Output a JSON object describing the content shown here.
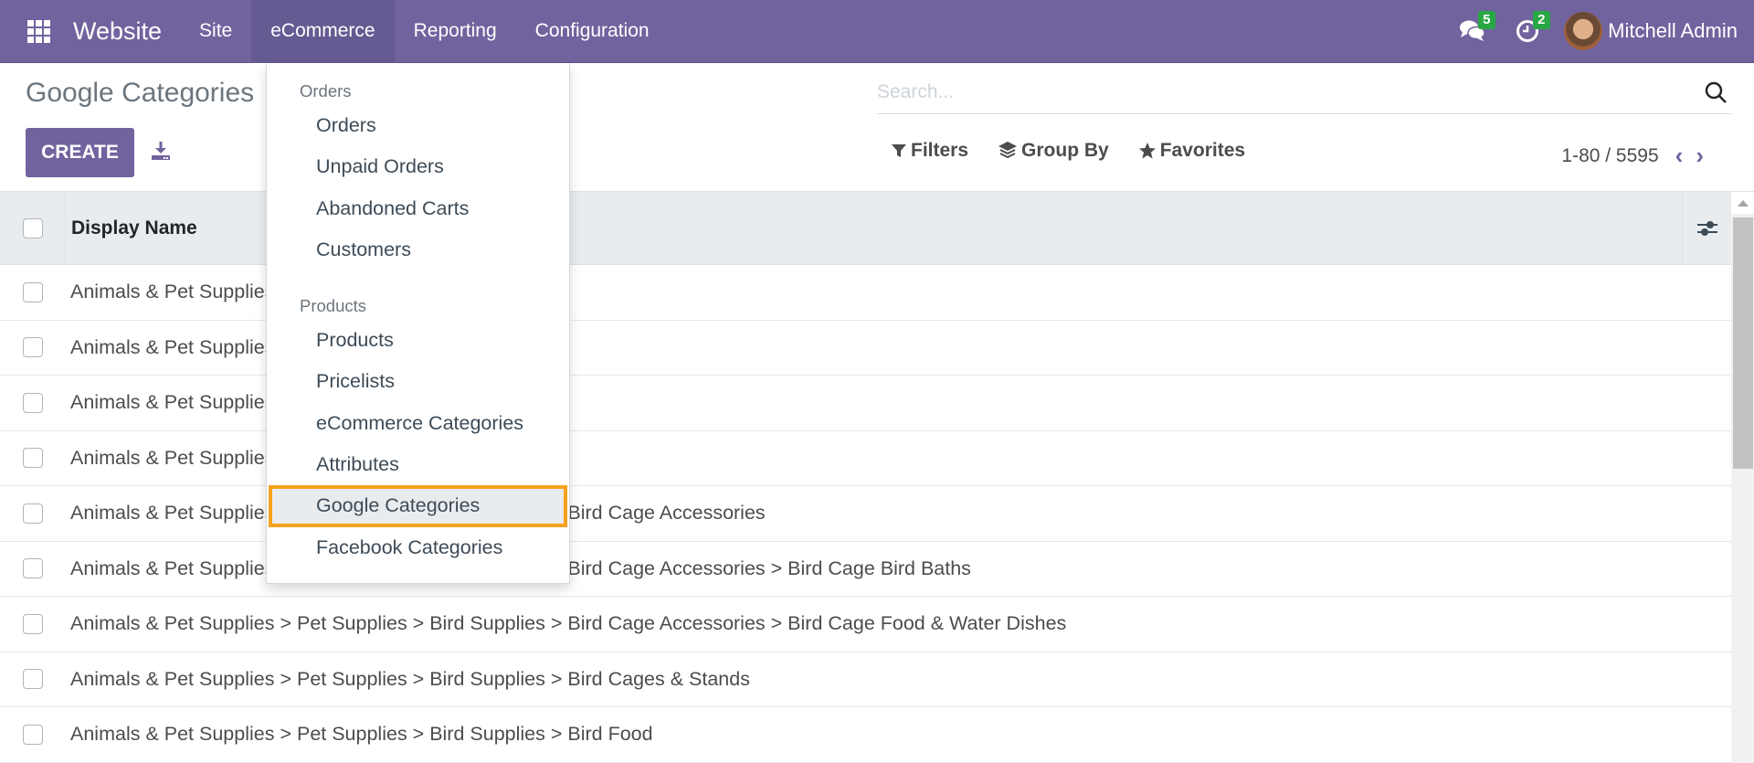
{
  "navbar": {
    "app_name": "Website",
    "menus": [
      "Site",
      "eCommerce",
      "Reporting",
      "Configuration"
    ],
    "active_menu": "eCommerce",
    "messages_count": "5",
    "activities_count": "2",
    "user_name": "Mitchell Admin",
    "colors": {
      "brand": "#71639e",
      "badge": "#28a745"
    }
  },
  "control_panel": {
    "title": "Google Categories",
    "create_label": "CREATE",
    "search_placeholder": "Search...",
    "filters_label": "Filters",
    "group_by_label": "Group By",
    "favorites_label": "Favorites",
    "pager": "1-80 / 5595"
  },
  "list": {
    "column_header": "Display Name",
    "rows": [
      "Animals & Pet Supplies",
      "Animals & Pet Supplies",
      "Animals & Pet Supplies",
      "Animals & Pet Supplies",
      "Animals & Pet Supplies > Pet Supplies > Bird Supplies > Bird Cage Accessories",
      "Animals & Pet Supplies > Pet Supplies > Bird Supplies > Bird Cage Accessories > Bird Cage Bird Baths",
      "Animals & Pet Supplies > Pet Supplies > Bird Supplies > Bird Cage Accessories > Bird Cage Food & Water Dishes",
      "Animals & Pet Supplies > Pet Supplies > Bird Supplies > Bird Cages & Stands",
      "Animals & Pet Supplies > Pet Supplies > Bird Supplies > Bird Food"
    ]
  },
  "dropdown": {
    "sections": [
      {
        "header": "Orders",
        "items": [
          "Orders",
          "Unpaid Orders",
          "Abandoned Carts",
          "Customers"
        ]
      },
      {
        "header": "Products",
        "items": [
          "Products",
          "Pricelists",
          "eCommerce Categories",
          "Attributes",
          "Google Categories",
          "Facebook Categories"
        ]
      }
    ],
    "highlighted_item": "Google Categories",
    "highlight_color": "#f6a21d"
  }
}
